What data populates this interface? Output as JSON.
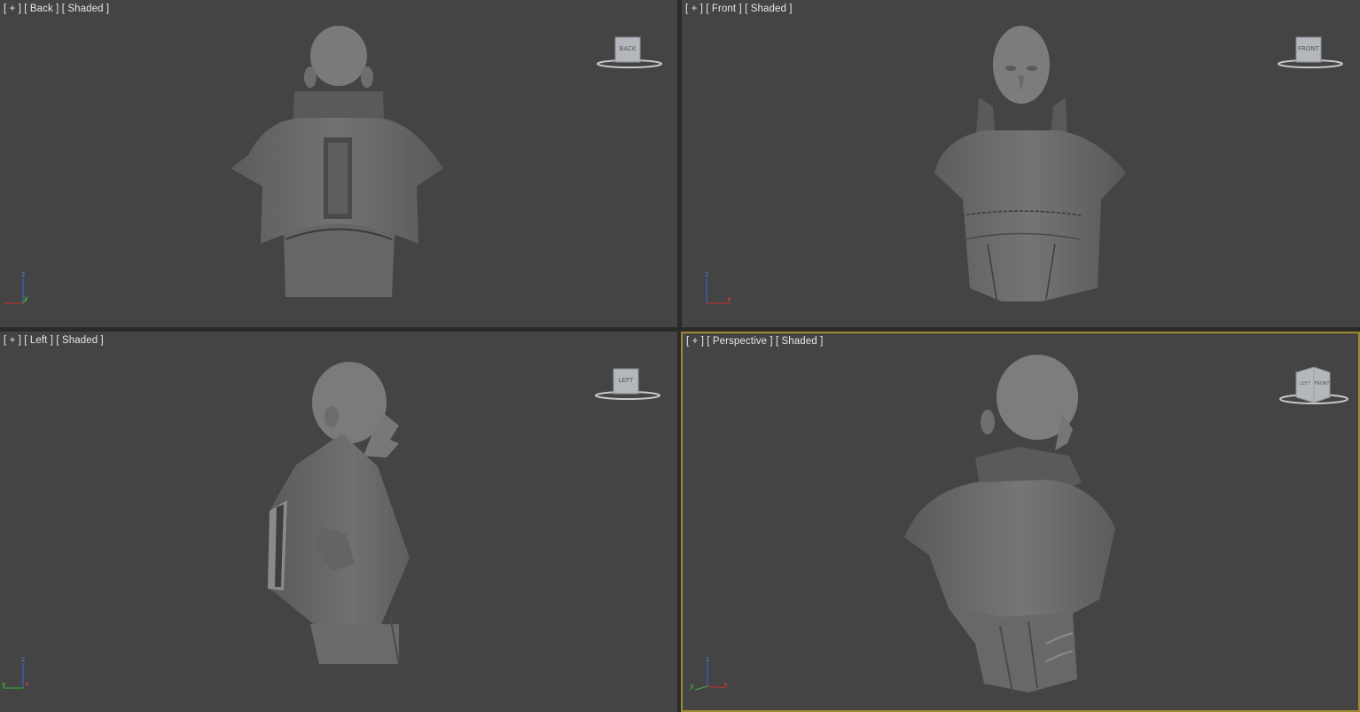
{
  "viewports": [
    {
      "id": "back",
      "label": "[ + ] [ Back ] [ Shaded ]",
      "cube_label": "BACK",
      "active": false
    },
    {
      "id": "front",
      "label": "[ + ] [ Front ] [ Shaded ]",
      "cube_label": "FRONT",
      "active": false
    },
    {
      "id": "left",
      "label": "[ + ] [ Left ] [ Shaded ]",
      "cube_label": "LEFT",
      "active": false
    },
    {
      "id": "perspective",
      "label": "[ + ] [ Perspective ] [ Shaded ]",
      "cube_label_left": "LEFT",
      "cube_label_right": "FRONT",
      "active": true
    }
  ],
  "axes": {
    "x": "x",
    "y": "y",
    "z": "z"
  },
  "colors": {
    "viewport_bg": "#444444",
    "active_border": "#a08a2f",
    "model_gray": "#6a6a6a",
    "label_text": "#e6e6e6",
    "axis_x": "#c83232",
    "axis_y": "#32b432",
    "axis_z": "#3c64dc"
  }
}
